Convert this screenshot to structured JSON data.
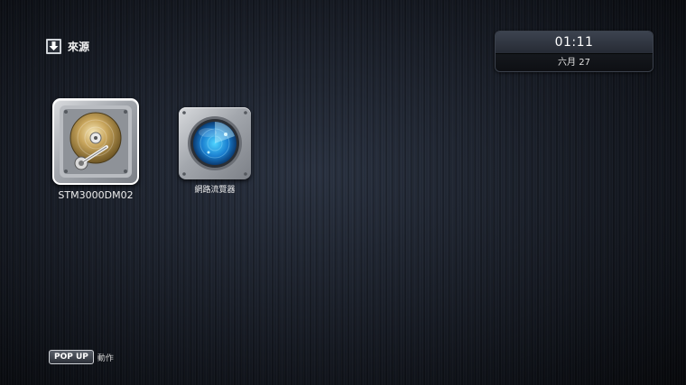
{
  "header": {
    "icon": "download-tray-icon",
    "title": "來源"
  },
  "clock": {
    "time": "01:11",
    "date": "六月 27"
  },
  "sources": [
    {
      "label": "STM3000DM02",
      "icon": "hard-drive-icon",
      "selected": true
    },
    {
      "label": "網路流覽器",
      "icon": "network-browser-icon",
      "selected": false
    }
  ],
  "footer": {
    "button_label": "POP UP",
    "action_label": "動作"
  }
}
